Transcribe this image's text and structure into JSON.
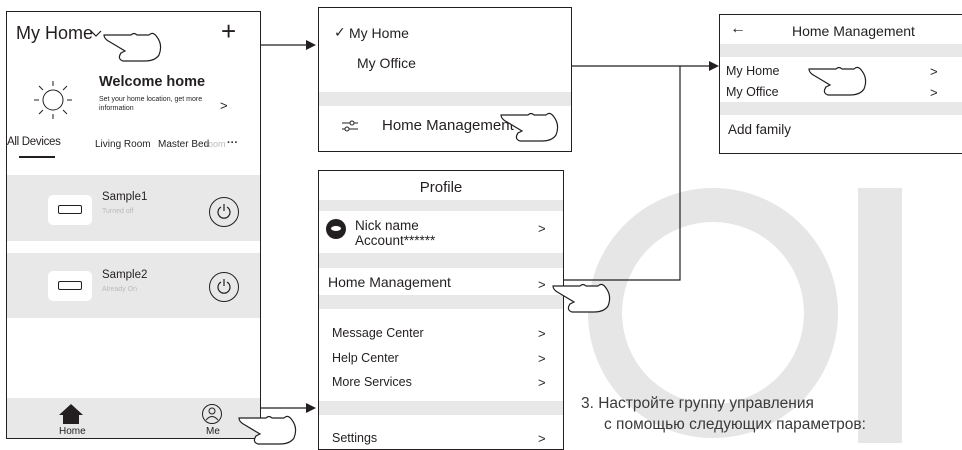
{
  "home_screen": {
    "home_title": "My Home",
    "add_icon": "+",
    "welcome_title": "Welcome home",
    "welcome_sub": "Set your home location, get more information",
    "welcome_chevron": ">",
    "tabs": [
      "All Devices",
      "Living Room",
      "Master Bed",
      "room",
      "···"
    ],
    "devices": [
      {
        "name": "Sample1",
        "status": "Turned off"
      },
      {
        "name": "Sample2",
        "status": "Already On"
      }
    ],
    "nav_home": "Home",
    "nav_me": "Me"
  },
  "home_dropdown": {
    "check": "✓",
    "items": [
      "My Home",
      "My  Office"
    ],
    "management_label": "Home Management"
  },
  "profile": {
    "title": "Profile",
    "nickname": "Nick name",
    "account": "Account******",
    "chevron": ">",
    "home_management": "Home Management",
    "menu": [
      "Message Center",
      "Help Center",
      "More Services"
    ],
    "settings": "Settings"
  },
  "home_management": {
    "back": "←",
    "title": "Home Management",
    "homes": [
      "My Home",
      "My  Office"
    ],
    "chevron": ">",
    "add_family": "Add family"
  },
  "caption": {
    "line1": "3. Настройте группу управления",
    "line2": "с помощью следующих параметров:"
  }
}
